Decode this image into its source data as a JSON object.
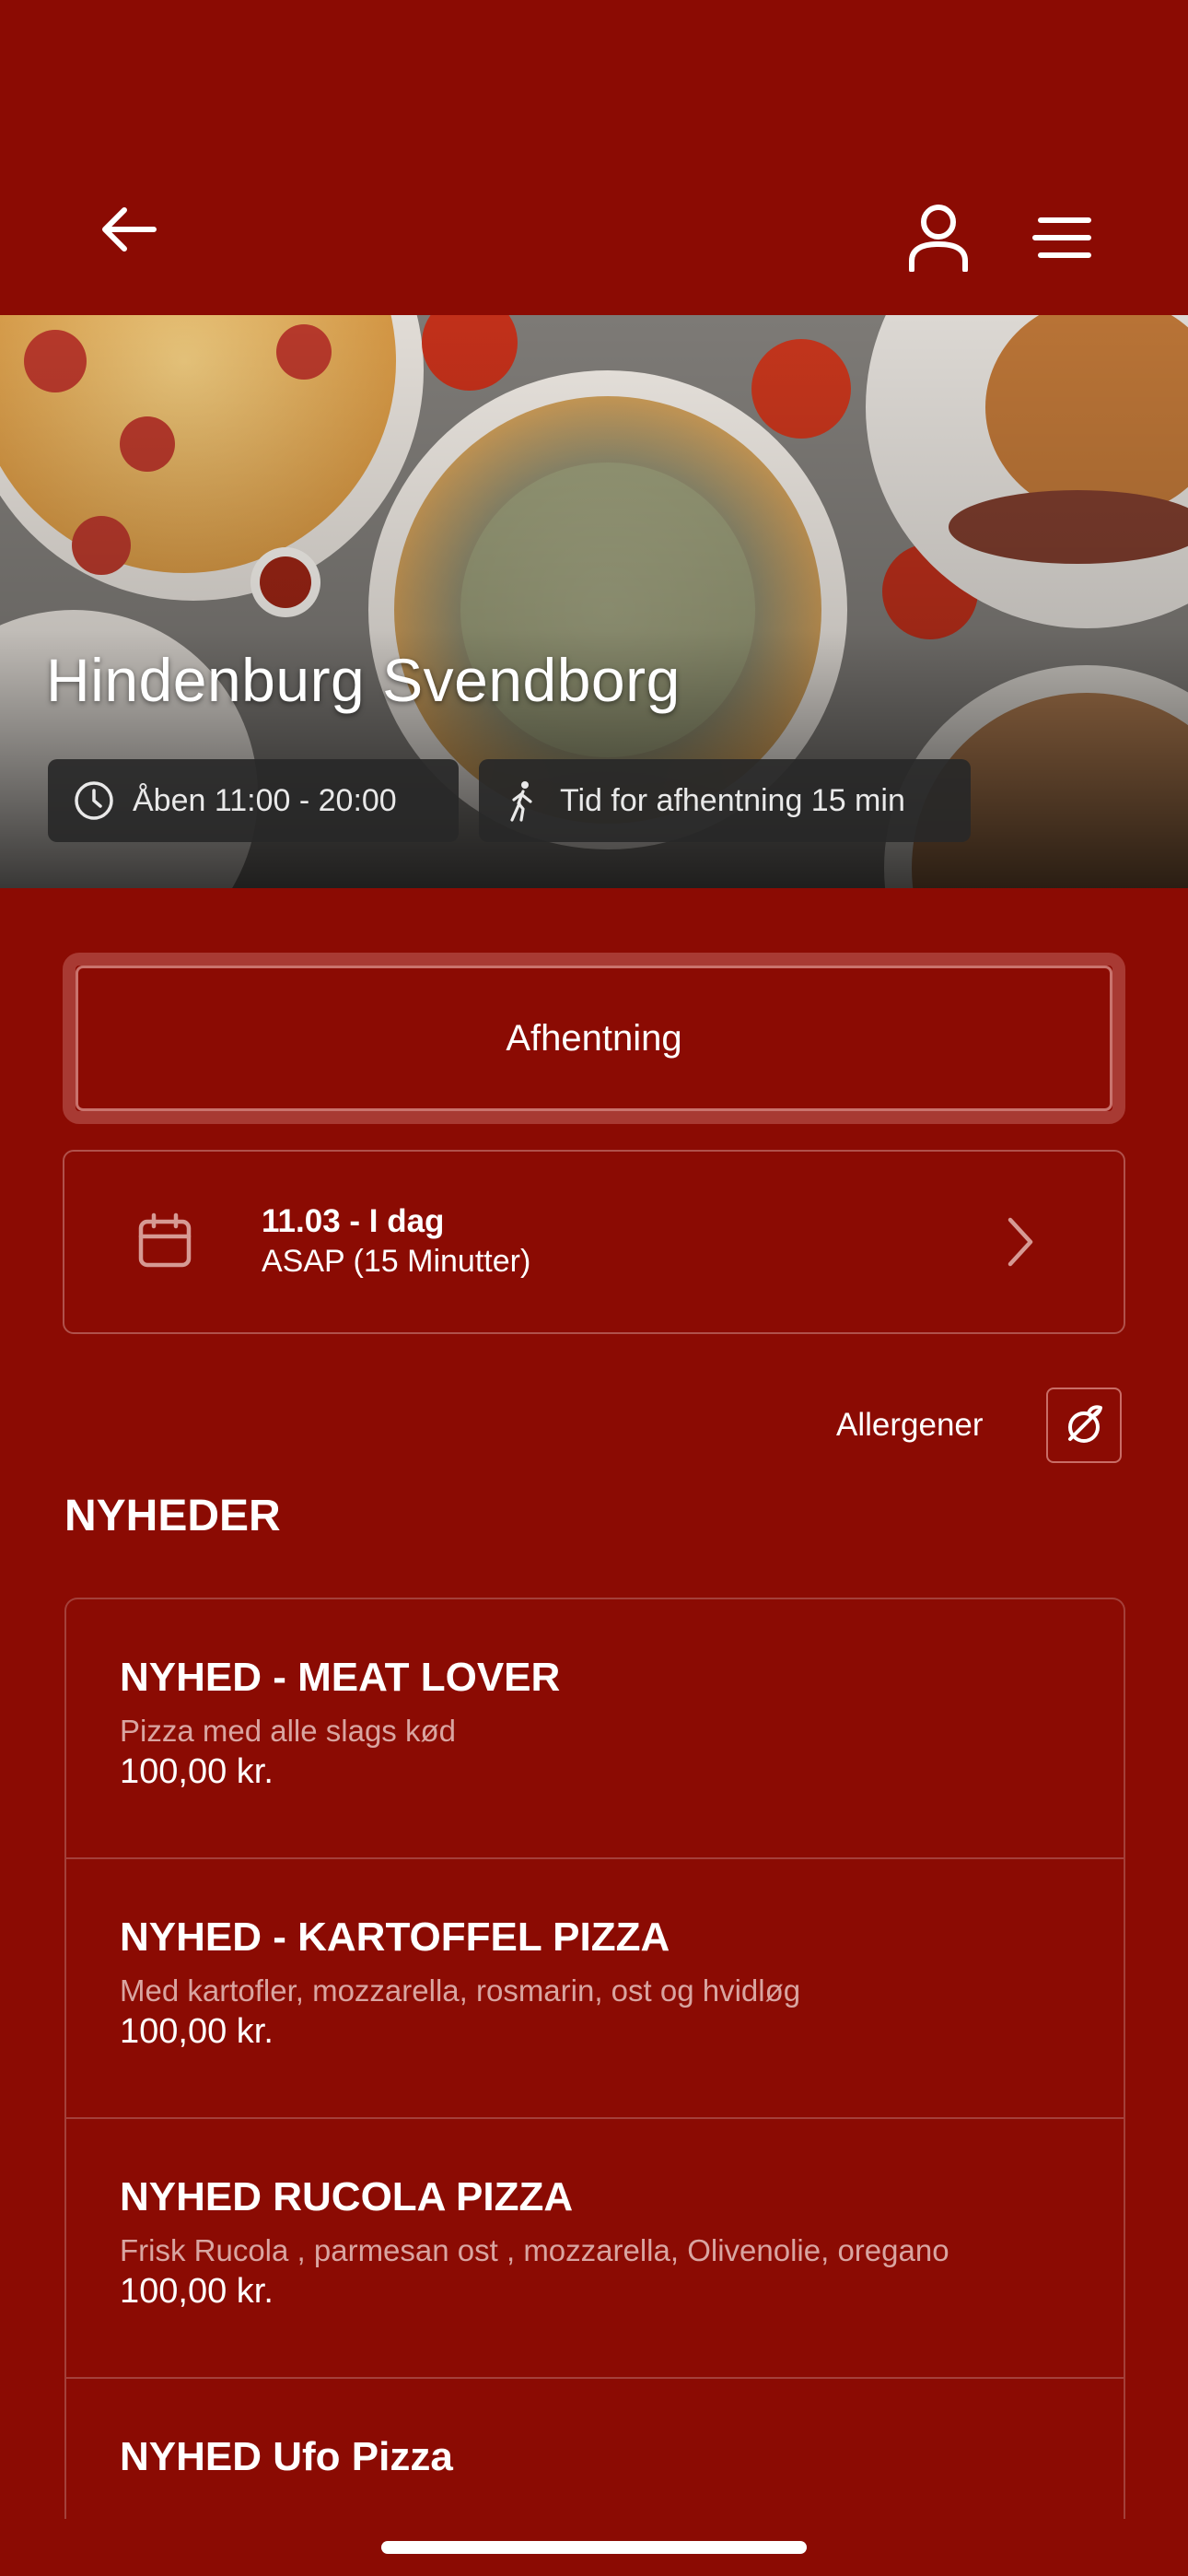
{
  "header": {
    "back_icon": "arrow-left-icon",
    "user_icon": "user-icon",
    "menu_icon": "hamburger-menu-icon"
  },
  "hero": {
    "title": "Hindenburg Svendborg",
    "open_hours": "Åben 11:00 - 20:00",
    "pickup_time": "Tid for afhentning 15 min"
  },
  "order": {
    "mode_label": "Afhentning",
    "date_main": "11.03 - I dag",
    "date_sub": "ASAP (15 Minutter)"
  },
  "allergens": {
    "label": "Allergener"
  },
  "section": {
    "title": "NYHEDER"
  },
  "menu_items": [
    {
      "name": "NYHED - MEAT LOVER",
      "desc": "Pizza med alle slags kød",
      "price": "100,00 kr."
    },
    {
      "name": "NYHED - KARTOFFEL PIZZA",
      "desc": "Med kartofler, mozzarella, rosmarin, ost og hvidløg",
      "price": "100,00 kr."
    },
    {
      "name": "NYHED RUCOLA PIZZA",
      "desc": "Frisk Rucola , parmesan ost , mozzarella, Olivenolie, oregano",
      "price": "100,00 kr."
    },
    {
      "name": "NYHED Ufo Pizza",
      "desc": "",
      "price": ""
    }
  ],
  "colors": {
    "background": "#8b0b03",
    "border": "#a4403a",
    "chip": "#282828"
  }
}
